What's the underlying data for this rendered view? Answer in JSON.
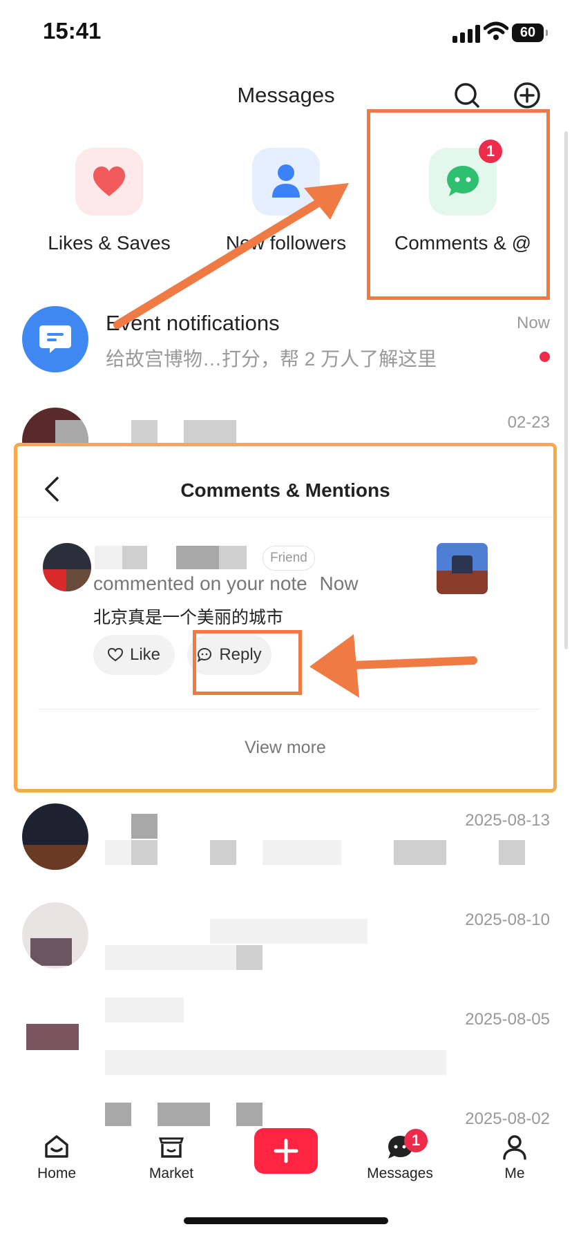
{
  "status_bar": {
    "time": "15:41",
    "battery": "60"
  },
  "header": {
    "title": "Messages",
    "search_icon": "search-icon",
    "add_icon": "plus-circle-icon"
  },
  "categories": [
    {
      "label": "Likes & Saves",
      "icon": "heart-icon",
      "color": "#f05a5a"
    },
    {
      "label": "New followers",
      "icon": "person-icon",
      "color": "#3b82f6"
    },
    {
      "label": "Comments & @",
      "icon": "chat-bubble-icon",
      "color": "#2fbf71",
      "badge": "1"
    }
  ],
  "event_row": {
    "title": "Event notifications",
    "subtitle": "给故宫博物…打分，帮 2 万人了解这里",
    "time": "Now"
  },
  "list": [
    {
      "time": "02-23"
    },
    {
      "time": "2025-08-13"
    },
    {
      "time": "2025-08-10"
    },
    {
      "time": "2025-08-05"
    },
    {
      "time": "2025-08-02"
    }
  ],
  "popup": {
    "title": "Comments & Mentions",
    "friend_tag": "Friend",
    "action_text": "commented on your note",
    "action_time": "Now",
    "comment": "北京真是一个美丽的城市",
    "like_label": "Like",
    "reply_label": "Reply",
    "view_more": "View more"
  },
  "tabs": [
    {
      "label": "Home",
      "icon": "home-icon"
    },
    {
      "label": "Market",
      "icon": "shop-icon"
    },
    {
      "label": "",
      "icon": "plus-icon"
    },
    {
      "label": "Messages",
      "icon": "message-icon",
      "badge": "1"
    },
    {
      "label": "Me",
      "icon": "profile-icon"
    }
  ],
  "colors": {
    "brand": "#ff2442",
    "annotation": "#ef7a44",
    "highlight": "#f9a94a"
  }
}
